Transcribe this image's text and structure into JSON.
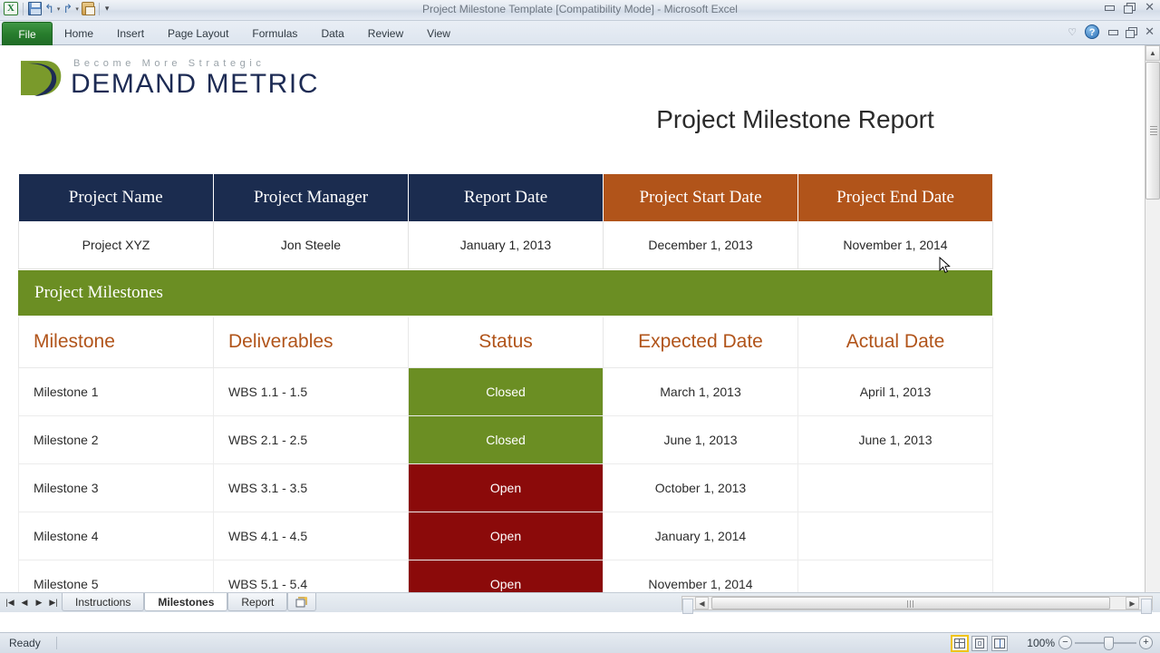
{
  "window": {
    "title": "Project Milestone Template  [Compatibility Mode]  -  Microsoft Excel",
    "minimize": "—",
    "restore": "❐",
    "close": "✕"
  },
  "quick_access": {
    "app_icon": "excel-icon",
    "save": "save-icon",
    "undo": "↰",
    "undo_caret": "▾",
    "redo": "↱",
    "redo_caret": "▾",
    "print_preview": "print-preview-icon",
    "customize": "▾"
  },
  "ribbon": {
    "file_tab": "File",
    "tabs": [
      "Home",
      "Insert",
      "Page Layout",
      "Formulas",
      "Data",
      "Review",
      "View"
    ],
    "heart_icon": "♡",
    "help": "?",
    "minimize_ribbon": "—",
    "restore_ribbon": "❐",
    "close_ribbon": "✕"
  },
  "logo": {
    "tagline": "Become More Strategic",
    "brand": "DEMAND METRIC",
    "colors": {
      "green": "#7a9a2b",
      "navy": "#1d2b54"
    }
  },
  "report": {
    "title": "Project Milestone Report"
  },
  "info_table": {
    "headers": [
      {
        "label": "Project Name",
        "style": "navy"
      },
      {
        "label": "Project Manager",
        "style": "navy"
      },
      {
        "label": "Report Date",
        "style": "navy"
      },
      {
        "label": "Project Start Date",
        "style": "orange"
      },
      {
        "label": "Project End Date",
        "style": "orange"
      }
    ],
    "values": [
      "Project XYZ",
      "Jon Steele",
      "January 1, 2013",
      "December 1, 2013",
      "November 1, 2014"
    ]
  },
  "milestones_section": {
    "band_label": "Project Milestones",
    "headers": [
      "Milestone",
      "Deliverables",
      "Status",
      "Expected Date",
      "Actual Date"
    ],
    "rows": [
      {
        "milestone": "Milestone 1",
        "deliverables": "WBS 1.1 - 1.5",
        "status": "Closed",
        "status_state": "closed",
        "expected": "March 1, 2013",
        "actual": "April 1, 2013"
      },
      {
        "milestone": "Milestone 2",
        "deliverables": "WBS 2.1 - 2.5",
        "status": "Closed",
        "status_state": "closed",
        "expected": "June 1, 2013",
        "actual": "June 1, 2013"
      },
      {
        "milestone": "Milestone 3",
        "deliverables": "WBS 3.1 - 3.5",
        "status": "Open",
        "status_state": "open",
        "expected": "October 1, 2013",
        "actual": ""
      },
      {
        "milestone": "Milestone 4",
        "deliverables": "WBS 4.1 - 4.5",
        "status": "Open",
        "status_state": "open",
        "expected": "January 1, 2014",
        "actual": ""
      },
      {
        "milestone": "Milestone 5",
        "deliverables": "WBS 5.1 - 5.4",
        "status": "Open",
        "status_state": "open",
        "expected": "November 1, 2014",
        "actual": ""
      },
      {
        "milestone": "",
        "deliverables": "",
        "status": "",
        "status_state": "blank",
        "expected": "",
        "actual": ""
      }
    ],
    "colors": {
      "band": "#6b8e23",
      "closed": "#6b8e23",
      "open": "#8b0a0a",
      "header_text": "#b1541a"
    }
  },
  "sheet_tabs": {
    "nav_first": "|◀",
    "nav_prev": "◀",
    "nav_next": "▶",
    "nav_last": "▶|",
    "tabs": [
      {
        "label": "Instructions",
        "active": false
      },
      {
        "label": "Milestones",
        "active": true
      },
      {
        "label": "Report",
        "active": false
      }
    ],
    "insert_sheet": "insert-worksheet-icon"
  },
  "scrollbars": {
    "v_up": "▲",
    "v_down": "▼",
    "h_left": "◀",
    "h_right": "▶"
  },
  "status_bar": {
    "state": "Ready",
    "view_normal": "normal-view-icon",
    "view_page_layout": "page-layout-view-icon",
    "view_page_break": "page-break-view-icon",
    "zoom_level": "100%",
    "zoom_out": "−",
    "zoom_in": "+"
  }
}
